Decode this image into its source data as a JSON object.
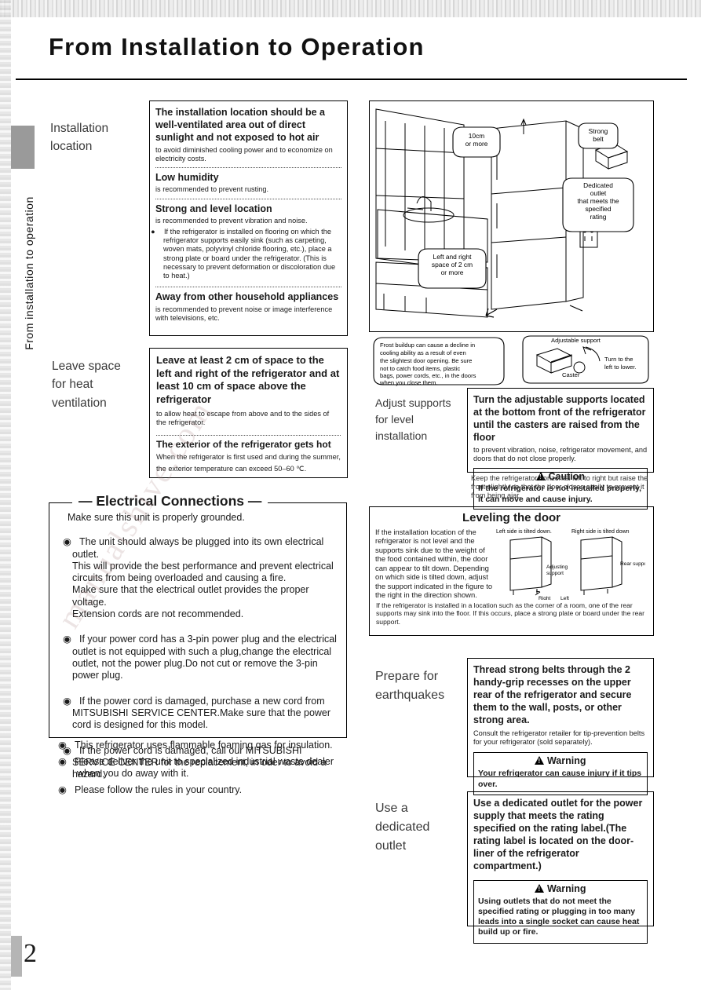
{
  "header": {
    "title": "From Installation to Operation",
    "side_tab": "From installation to operation",
    "page_number": "2"
  },
  "watermark": "manualshive.com",
  "installation_location": {
    "label_line1": "Installation",
    "label_line2": "location",
    "items": [
      {
        "heading": "The installation location should be a well-ventilated area out of direct sunlight and not exposed to hot air",
        "body": "to avoid diminished cooling power and to economize on electricity costs."
      },
      {
        "heading": "Low humidity",
        "body": "is recommended to prevent rusting."
      },
      {
        "heading": "Strong and level location",
        "body": "is recommended to prevent vibration and noise.",
        "note": "If the refrigerator is installed on flooring on which the refrigerator supports easily sink (such as carpeting, woven mats, polyvinyl chloride flooring, etc.), place a strong plate or board under the refrigerator. (This is necessary to prevent deformation or discoloration due to heat.)"
      },
      {
        "heading": "Away from other household appliances",
        "body": "is recommended to prevent noise or image interference with televisions, etc."
      }
    ]
  },
  "leave_space": {
    "label_line1": "Leave space",
    "label_line2": "for heat",
    "label_line3": "ventilation",
    "heading": "Leave at least 2 cm of space to the left and right of the refrigerator and at least 10 cm of space above the refrigerator",
    "body": "to allow heat to escape from above and to the sides of the refrigerator.",
    "heading2": "The exterior of the refrigerator gets hot",
    "body2a": "When the refrigerator is first used and during the summer,",
    "body2b": "the exterior temperature can exceed 50–60 ℃."
  },
  "electrical": {
    "title": "Electrical Connections",
    "intro": "Make sure this unit is properly grounded.",
    "bullets": [
      "The unit should always be plugged into its own electrical outlet.\nThis will provide the best performance and prevent electrical circuits from being overloaded and causing a fire.\nMake sure that the electrical outlet provides the proper voltage.\nExtension cords are not recommended.",
      "If your power cord has a 3-pin power plug and the electrical outlet is not equipped with such a plug,change the electrical outlet, not the power plug.Do not cut or remove the 3-pin power plug.",
      "If the power cord is damaged, purchase a new cord from MITSUBISHI SERVICE CENTER.Make sure that the power cord is designed for this model.",
      "If the power cord is damaged, call our MITSUBISHI SERVICE CENTER for the replacement, in oder to avoid a hazard."
    ],
    "outside_bullets": [
      "This refrigerator uses flammable foaming gas for insulation.",
      "Please deliver the unit to specialized industrial waste dealer when you do away with it.",
      "Please follow the rules in your country."
    ]
  },
  "illustration_top": {
    "callouts": [
      "10cm\nor more",
      "Strong\nbelt",
      "Dedicated\noutlet\nthat meets the\nspecified\nrating",
      "Left and right\nspace of 2 cm\nor more"
    ],
    "frost_note": "Frost buildup can cause a decline in cooling ability as a result of even the slightest door opening. Be sure not to catch food items, plastic bags, power cords, etc., in the doors when you close them.",
    "adjustable_support": "Adjustable support",
    "caster": "Caster",
    "turn_note": "Turn to the\nleft to lower."
  },
  "adjust_supports": {
    "label_line1": "Adjust supports",
    "label_line2": "for level",
    "label_line3": "installation",
    "heading": "Turn the adjustable supports located at the bottom front of the refrigerator until the casters are raised from the floor",
    "body": "to prevent vibration, noise, refrigerator movement, and doors that do not close properly.",
    "caution_title": "Caution",
    "caution_text": "If the refrigerator is not installed properly, it can move and cause injury.",
    "footnote": "Keep the refrigerator horizontal left to right but raise the front slightly so that the door closes easily to prevent it from being ajar."
  },
  "leveling": {
    "title": "Leveling the door",
    "body": "If the installation location of the refrigerator is not level and the supports sink due to the weight of the food contained within, the door can appear to tilt down. Depending on which side is tilted down, adjust the support indicated in the figure to the right in the direction shown.",
    "footnote": "If the refrigerator is installed in a location such as the corner of a room, one of the rear supports may sink into the floor. If this occurs, place a strong plate or board under the rear support.",
    "fig_left_label": "Left side is tilted down.",
    "fig_right_label": "Right side is tilted down",
    "adjusting_support": "Adjusting\nsupport",
    "rear_support": "Rear support",
    "right_label": "Right",
    "left_label": "Left"
  },
  "earthquakes": {
    "label_line1": "Prepare for",
    "label_line2": "earthquakes",
    "heading": "Thread strong belts through the 2 handy-grip recesses on the upper rear of the refrigerator and secure them to the wall, posts, or other strong area.",
    "body": "Consult the refrigerator retailer for tip-prevention belts for your refrigerator (sold separately).",
    "warning_title": "Warning",
    "warning_text": "Your refrigerator can cause injury if it tips over."
  },
  "dedicated_outlet": {
    "label_line1": "Use a",
    "label_line2": "dedicated",
    "label_line3": "outlet",
    "heading": "Use a dedicated outlet for the power supply that meets the rating specified on the rating label.(The rating label is located on the door-liner of the refrigerator compartment.)",
    "warning_title": "Warning",
    "warning_text": "Using outlets that do not meet the specified rating or plugging in too many leads into a single socket can cause heat build up or fire."
  }
}
